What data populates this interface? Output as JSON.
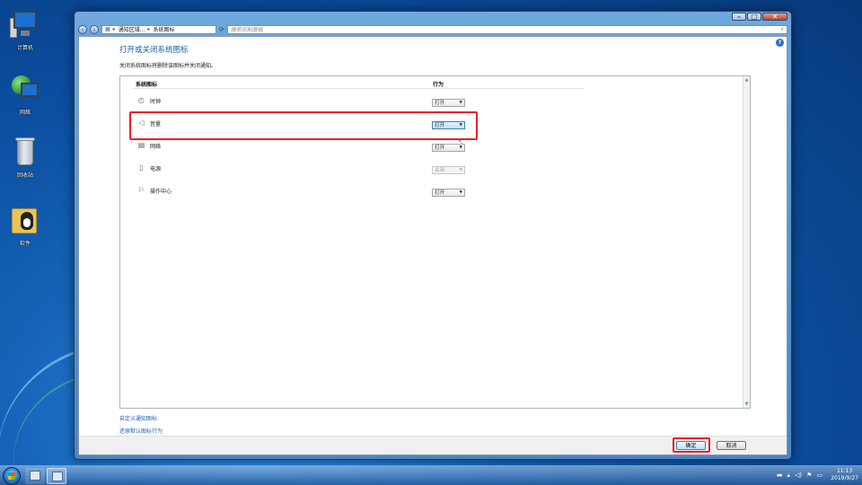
{
  "desktop": {
    "icons": [
      {
        "label": "计算机"
      },
      {
        "label": "网络"
      },
      {
        "label": "回收站"
      },
      {
        "label": "软件"
      }
    ]
  },
  "window": {
    "address": {
      "crumb1": "通知区域...",
      "sep": "▸",
      "crumb2": "系统图标"
    },
    "search_placeholder": "搜索控制面板",
    "title": "打开或关闭系统图标",
    "description": "关闭系统图标将删除该图标并关闭通知。",
    "columns": {
      "icon": "系统图标",
      "behavior": "行为"
    },
    "rows": [
      {
        "name": "时钟",
        "value": "打开",
        "icon": "clock-icon"
      },
      {
        "name": "音量",
        "value": "打开",
        "icon": "volume-icon"
      },
      {
        "name": "网络",
        "value": "打开",
        "icon": "network-icon"
      },
      {
        "name": "电源",
        "value": "关闭",
        "icon": "power-icon"
      },
      {
        "name": "操作中心",
        "value": "打开",
        "icon": "flag-icon"
      }
    ],
    "links": {
      "customize": "自定义通知图标",
      "restore": "还原默认图标行为"
    },
    "buttons": {
      "ok": "确定",
      "cancel": "取消"
    }
  },
  "taskbar": {
    "time": "11:13",
    "date": "2019/9/27"
  },
  "colors": {
    "highlight": "#e8212a",
    "link": "#1f5fb0",
    "title": "#1e5aa8"
  }
}
